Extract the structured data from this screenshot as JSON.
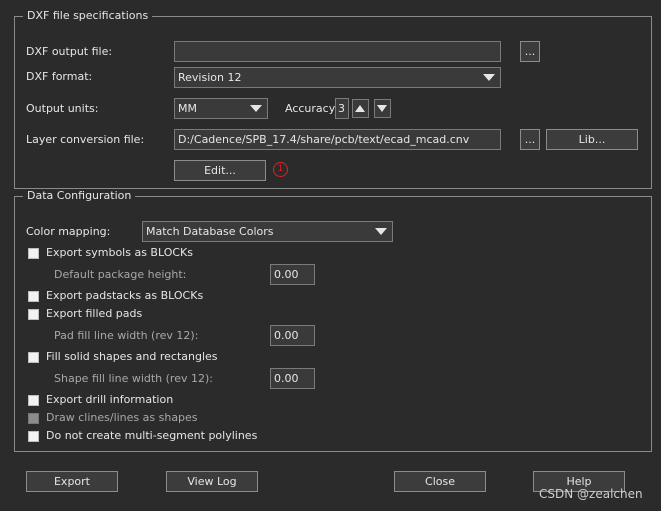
{
  "dxf_spec": {
    "legend": "DXF file specifications",
    "output_file_label": "DXF output file:",
    "output_file_value": "",
    "browse_label": "...",
    "format_label": "DXF format:",
    "format_value": "Revision 12",
    "units_label": "Output units:",
    "units_value": "MM",
    "accuracy_label": "Accuracy:",
    "accuracy_value": "3",
    "layer_conv_label": "Layer conversion file:",
    "layer_conv_value": "D:/Cadence/SPB_17.4/share/pcb/text/ecad_mcad.cnv",
    "lib_label": "Lib...",
    "edit_label": "Edit...",
    "marker": "1"
  },
  "data_config": {
    "legend": "Data Configuration",
    "color_mapping_label": "Color mapping:",
    "color_mapping_value": "Match Database Colors",
    "options": {
      "symbols": "Export symbols as BLOCKs",
      "pkg_height_label": "Default package height:",
      "pkg_height_value": "0.00",
      "padstacks": "Export padstacks as BLOCKs",
      "filled_pads": "Export filled pads",
      "pad_fill_label": "Pad fill line width (rev 12):",
      "pad_fill_value": "0.00",
      "solid_shapes": "Fill solid shapes and rectangles",
      "shape_fill_label": "Shape fill line width (rev 12):",
      "shape_fill_value": "0.00",
      "drill": "Export drill information",
      "clines": "Draw clines/lines as shapes",
      "polylines": "Do not create multi-segment polylines"
    }
  },
  "footer": {
    "export": "Export",
    "view_log": "View Log",
    "close": "Close",
    "help": "Help",
    "watermark": "CSDN @zealchen"
  }
}
